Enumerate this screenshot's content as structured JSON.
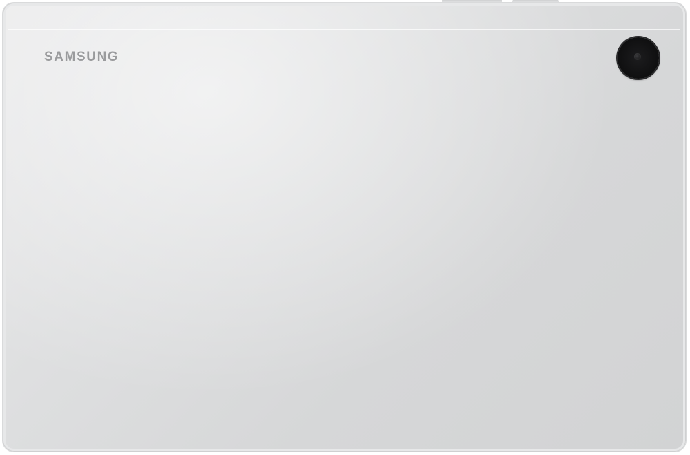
{
  "product": {
    "brand_text": "SAMSUNG",
    "icons": {
      "camera": "camera-icon"
    },
    "colors": {
      "body": "#dcdddf",
      "brand_text": "#9a9b9d",
      "camera": "#0f0f10"
    }
  }
}
